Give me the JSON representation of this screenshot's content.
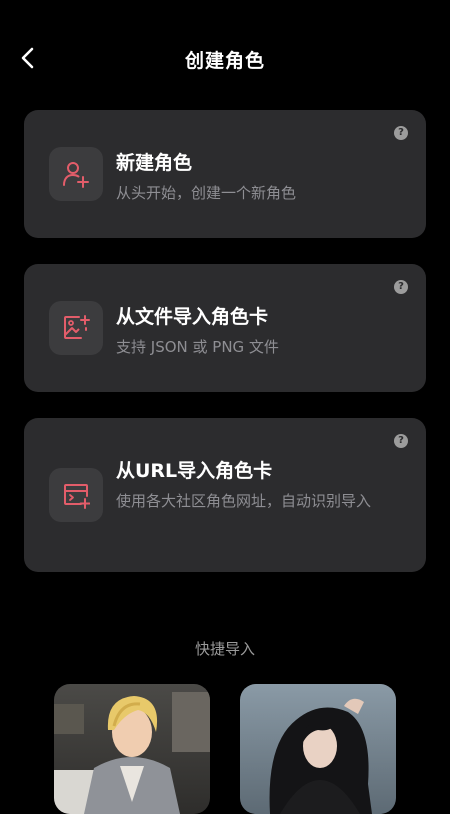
{
  "header": {
    "title": "创建角色"
  },
  "cards": [
    {
      "title": "新建角色",
      "desc": "从头开始，创建一个新角色",
      "icon": "add-person-icon"
    },
    {
      "title": "从文件导入角色卡",
      "desc": "支持 JSON 或 PNG 文件",
      "icon": "image-add-icon"
    },
    {
      "title": "从URL导入角色卡",
      "desc": "使用各大社区角色网址，自动识别导入",
      "icon": "window-add-icon"
    }
  ],
  "help_glyph": "?",
  "quick_import": {
    "label": "快捷导入"
  },
  "colors": {
    "accent": "#e35d6a",
    "card_bg": "#2c2c2e",
    "icon_bg": "#3c3c3e",
    "secondary_text": "#8e8e93"
  }
}
